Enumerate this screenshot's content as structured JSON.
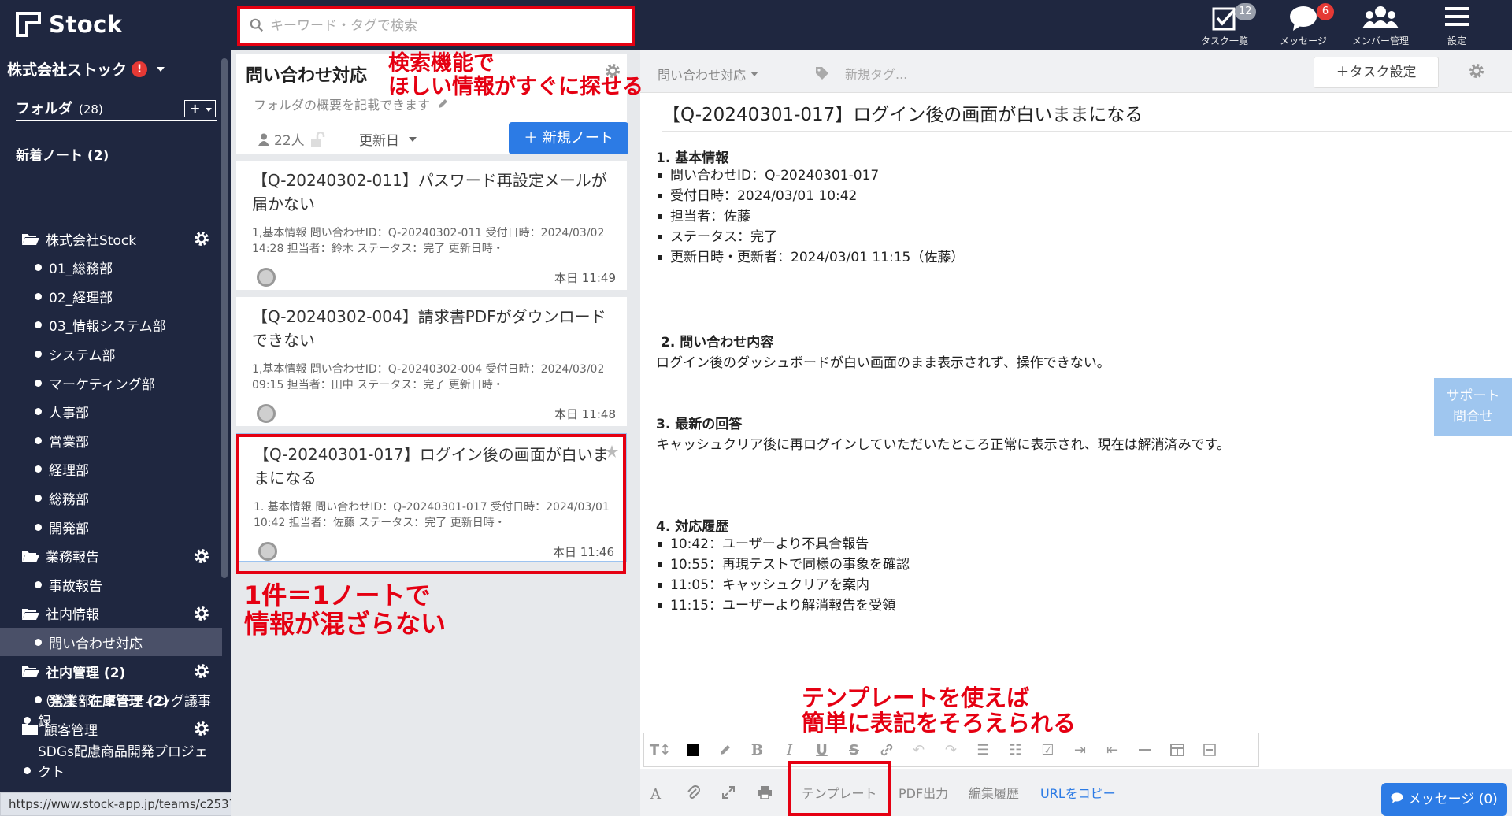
{
  "app": {
    "name": "Stock",
    "search_placeholder": "キーワード・タグで検索"
  },
  "topnav": [
    {
      "label": "タスク一覧",
      "badge": "12",
      "badge_color": "#9aa0ac"
    },
    {
      "label": "メッセージ",
      "badge": "6",
      "badge_color": "#e53935"
    },
    {
      "label": "メンバー管理",
      "badge": ""
    },
    {
      "label": "設定",
      "badge": ""
    }
  ],
  "sidebar": {
    "company": "株式会社ストック",
    "alert": "!",
    "folder_label": "フォルダ",
    "folder_count": "(28)",
    "add_label": "+",
    "new_notes": "新着ノート (2)",
    "rows": [
      {
        "text": "株式会社Stock",
        "kind": "folder",
        "gear": true
      },
      {
        "text": "01_総務部",
        "kind": "item"
      },
      {
        "text": "02_経理部",
        "kind": "item"
      },
      {
        "text": "03_情報システム部",
        "kind": "item"
      },
      {
        "text": "システム部",
        "kind": "item"
      },
      {
        "text": "マーケティング部",
        "kind": "item"
      },
      {
        "text": "人事部",
        "kind": "item"
      },
      {
        "text": "営業部",
        "kind": "item"
      },
      {
        "text": "経理部",
        "kind": "item"
      },
      {
        "text": "総務部",
        "kind": "item"
      },
      {
        "text": "開発部",
        "kind": "item"
      },
      {
        "text": "業務報告",
        "kind": "folder",
        "gear": true
      },
      {
        "text": "事故報告",
        "kind": "item"
      },
      {
        "text": "社内情報",
        "kind": "folder",
        "gear": true
      },
      {
        "text": "問い合わせ対応",
        "kind": "item",
        "active": true
      },
      {
        "text": "社内管理 (2)",
        "kind": "folder",
        "gear": true,
        "bold": true
      },
      {
        "text": "発注・在庫管理 (2)",
        "kind": "item",
        "bold": true
      },
      {
        "text": "顧客管理",
        "kind": "folder-closed",
        "gear": true
      }
    ],
    "wrapped_items": [
      "（営業部）ミーティング議事録",
      "SDGs配慮商品開発プロジェクト"
    ]
  },
  "status_url": "https://www.stock-app.jp/teams/c253708/dashboard/1922586/stocks/22292863/edit",
  "folder": {
    "title": "問い合わせ対応",
    "description": "フォルダの概要を記載できます",
    "members": "22人",
    "sort_label": "更新日",
    "new_note_label": "＋ 新規ノート"
  },
  "notes": [
    {
      "title": "【Q-20240302-011】パスワード再設定メールが届かない",
      "excerpt": "1,基本情報 問い合わせID：Q-20240302-011 受付日時：2024/03/02 14:28 担当者：鈴木 ステータス：完了 更新日時・",
      "time": "本日 11:49"
    },
    {
      "title": "【Q-20240302-004】請求書PDFがダウンロードできない",
      "excerpt": "1,基本情報 問い合わせID：Q-20240302-004 受付日時：2024/03/02 09:15 担当者：田中 ステータス：完了 更新日時・",
      "time": "本日 11:48"
    },
    {
      "title": "【Q-20240301-017】ログイン後の画面が白いままになる",
      "excerpt": "1. 基本情報 問い合わせID：Q-20240301-017 受付日時：2024/03/01 10:42 担当者：佐藤 ステータス：完了 更新日時・",
      "time": "本日 11:46"
    }
  ],
  "editor": {
    "folder_label": "問い合わせ対応",
    "tag_placeholder": "新規タグ...",
    "task_button": "＋タスク設定",
    "title": "【Q-20240301-017】ログイン後の画面が白いままになる",
    "sections": {
      "basic_title": "1. 基本情報",
      "basic_items": [
        "問い合わせID：Q-20240301-017",
        "受付日時：2024/03/01 10:42",
        "担当者：佐藤",
        "ステータス：完了",
        "更新日時・更新者：2024/03/01 11:15（佐藤）"
      ],
      "inquiry_title": "2. 問い合わせ内容",
      "inquiry_text": "ログイン後のダッシュボードが白い画面のまま表示されず、操作できない。",
      "answer_title": "3. 最新の回答",
      "answer_text": "キャッシュクリア後に再ログインしていただいたところ正常に表示され、現在は解消済みです。",
      "history_title": "4. 対応履歴",
      "history_items": [
        "10:42：ユーザーより不具合報告",
        "10:55：再現テストで同様の事象を確認",
        "11:05：キャッシュクリアを案内",
        "11:15：ユーザーより解消報告を受領"
      ]
    },
    "support_line1": "サポート",
    "support_line2": "問合せ",
    "bottom": {
      "template": "テンプレート",
      "pdf": "PDF出力",
      "history": "編集履歴",
      "copy_url": "URLをコピー",
      "message": "メッセージ (0)"
    }
  },
  "annotations": {
    "search_1": "検索機能で",
    "search_2": "ほしい情報がすぐに探せる",
    "note_1": "1件＝1ノートで",
    "note_2": "情報が混ざらない",
    "template_1": "テンプレートを使えば",
    "template_2": "簡単に表記をそろえられる"
  },
  "colors": {
    "header_bg": "#1f2740",
    "highlight_red": "#e50012",
    "primary_blue": "#2c7be5"
  }
}
